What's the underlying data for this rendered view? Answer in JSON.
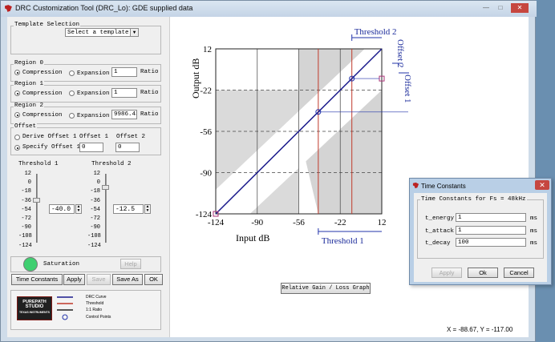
{
  "window": {
    "title": "DRC Customization Tool (DRC_Lo): GDE supplied data"
  },
  "template": {
    "group_label": "Template Selection",
    "select_value": "Select a template"
  },
  "regions": [
    {
      "label": "Region 0",
      "compression": "Compression",
      "expansion": "Expansion",
      "ratio_value": "1",
      "ratio_label": "Ratio",
      "selected": "compression"
    },
    {
      "label": "Region 1",
      "compression": "Compression",
      "expansion": "Expansion",
      "ratio_value": "1",
      "ratio_label": "Ratio",
      "selected": "compression"
    },
    {
      "label": "Region 2",
      "compression": "Compression",
      "expansion": "Expansion",
      "ratio_value": "9986.43",
      "ratio_label": "Ratio",
      "selected": "compression"
    }
  ],
  "offset": {
    "group_label": "Offset",
    "derive": "Derive Offset 1",
    "specify": "Specify Offset 1",
    "offset1_label": "Offset 1",
    "offset2_label": "Offset 2",
    "offset1_value": "0",
    "offset2_value": "0"
  },
  "threshold1": {
    "label": "Threshold 1",
    "value": "-40.0"
  },
  "threshold2": {
    "label": "Threshold 2",
    "value": "-12.5"
  },
  "slider_scale": [
    "12",
    "0",
    "-18",
    "-36",
    "-54",
    "-72",
    "-90",
    "-108",
    "-124"
  ],
  "saturation": {
    "label": "Saturation",
    "help": "Help",
    "led_color": "#3fcf70"
  },
  "buttons": {
    "time_constants": "Time Constants",
    "apply": "Apply",
    "save": "Save",
    "save_as": "Save As",
    "ok": "OK"
  },
  "logo": {
    "line1": "PUREPATH",
    "line2": "STUDIO",
    "line3": "TEXAS INSTRUMENTS"
  },
  "legend": [
    "DRC Curve",
    "Threshold",
    "1:1 Ratio",
    "Control Points"
  ],
  "graph": {
    "x_axis_label": "Input dB",
    "y_axis_label": "Output dB",
    "x_ticks": [
      "-124",
      "-90",
      "-56",
      "-22",
      "12"
    ],
    "y_ticks": [
      "12",
      "-22",
      "-56",
      "-90",
      "-124"
    ],
    "threshold1_label": "Threshold 1",
    "threshold2_label": "Threshold 2",
    "offset1_label": "Offset 1",
    "offset2_label": "Offset 2",
    "graph_button": "Relative Gain / Loss Graph",
    "coords": "X = -88.67, Y = -117.00",
    "curve_color": "#1a1a8c",
    "threshold_color": "#c0392b"
  },
  "dialog": {
    "title": "Time Constants",
    "group_label": "Time Constants for Fs = 48kHz",
    "fields": [
      {
        "label": "t_energy",
        "value": "1",
        "unit": "ms"
      },
      {
        "label": "t_attack",
        "value": "1",
        "unit": "ms"
      },
      {
        "label": "t_decay",
        "value": "100",
        "unit": "ms"
      }
    ],
    "apply": "Apply",
    "ok": "Ok",
    "cancel": "Cancel"
  }
}
